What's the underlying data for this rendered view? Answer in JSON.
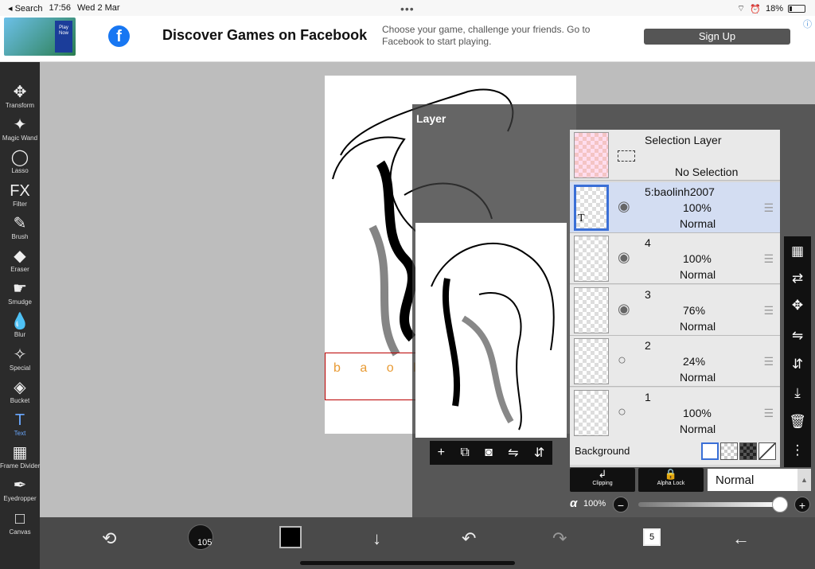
{
  "status": {
    "back": "◂ Search",
    "time": "17:56",
    "date": "Wed 2 Mar",
    "battery": "18%"
  },
  "ad": {
    "headline": "Discover Games on Facebook",
    "description": "Choose your game, challenge your friends. Go to Facebook to start playing.",
    "cta": "Sign Up",
    "thumb_text": "Play Now"
  },
  "tools": [
    {
      "name": "Transform",
      "icon": "✥"
    },
    {
      "name": "Magic Wand",
      "icon": "✦"
    },
    {
      "name": "Lasso",
      "icon": "◯"
    },
    {
      "name": "Filter",
      "icon": "FX"
    },
    {
      "name": "Brush",
      "icon": "✎"
    },
    {
      "name": "Eraser",
      "icon": "◆"
    },
    {
      "name": "Smudge",
      "icon": "☛"
    },
    {
      "name": "Blur",
      "icon": "💧"
    },
    {
      "name": "Special",
      "icon": "✧"
    },
    {
      "name": "Bucket",
      "icon": "◈"
    },
    {
      "name": "Text",
      "icon": "T"
    },
    {
      "name": "Frame Divider",
      "icon": "▦"
    },
    {
      "name": "Eyedropper",
      "icon": "✒"
    },
    {
      "name": "Canvas",
      "icon": "□"
    }
  ],
  "active_tool": "Text",
  "canvas_text": "b a o l",
  "panel": {
    "title": "Layer"
  },
  "selection_layer": {
    "name": "Selection Layer",
    "state": "No Selection"
  },
  "layers": [
    {
      "name": "5:baolinh2007",
      "opacity": "100%",
      "blend": "Normal",
      "visible": true,
      "selected": true
    },
    {
      "name": "4",
      "opacity": "100%",
      "blend": "Normal",
      "visible": true,
      "selected": false
    },
    {
      "name": "3",
      "opacity": "76%",
      "blend": "Normal",
      "visible": true,
      "selected": false
    },
    {
      "name": "2",
      "opacity": "24%",
      "blend": "Normal",
      "visible": false,
      "selected": false
    },
    {
      "name": "1",
      "opacity": "100%",
      "blend": "Normal",
      "visible": false,
      "selected": false
    }
  ],
  "background": {
    "label": "Background"
  },
  "clipping": "Clipping",
  "alpha_lock": "Alpha Lock",
  "blend_mode": "Normal",
  "alpha": {
    "symbol": "α",
    "value": "100%"
  },
  "brush_size": "105",
  "layer_count": "5"
}
